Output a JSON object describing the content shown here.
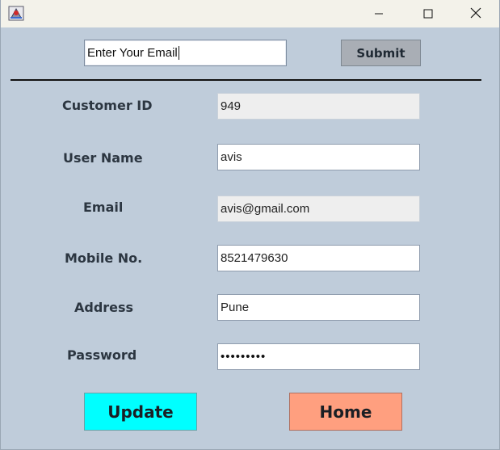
{
  "titlebar": {
    "icons": [
      "java-app-icon",
      "minimize-icon",
      "maximize-icon",
      "close-icon"
    ]
  },
  "search": {
    "value": "Enter Your Email",
    "submit_label": "Submit"
  },
  "form": {
    "fields": [
      {
        "label": "Customer ID",
        "value": "949"
      },
      {
        "label": "User Name",
        "value": "avis"
      },
      {
        "label": "Email",
        "value": "avis@gmail.com"
      },
      {
        "label": "Mobile No.",
        "value": "8521479630"
      },
      {
        "label": "Address",
        "value": "Pune"
      },
      {
        "label": "Password",
        "value": "•••••••••"
      }
    ]
  },
  "actions": {
    "update_label": "Update",
    "home_label": "Home"
  },
  "colors": {
    "background": "#bfccda",
    "update_button": "#00ffff",
    "home_button": "#ff9f7f",
    "submit_button": "#a9aeb5"
  }
}
